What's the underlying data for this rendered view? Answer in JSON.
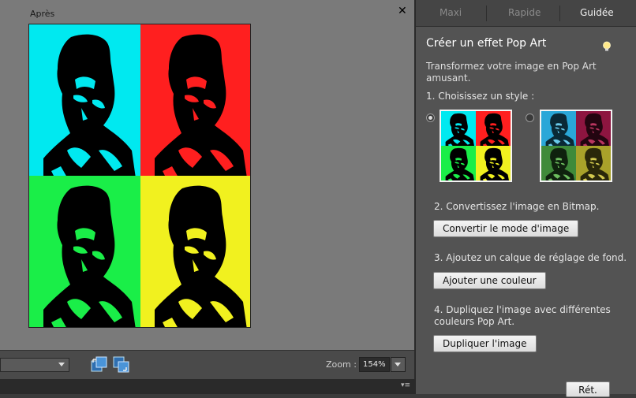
{
  "canvas": {
    "title": "Après",
    "close_symbol": "✕",
    "zoom_label": "Zoom :",
    "zoom_value": "154%"
  },
  "tabs": [
    {
      "label": "Maxi",
      "active": false
    },
    {
      "label": "Rapide",
      "active": false
    },
    {
      "label": "Guidée",
      "active": true
    }
  ],
  "panel": {
    "title": "Créer un effet Pop Art",
    "description": "Transformez votre image en Pop Art amusant.",
    "step1": "1. Choisissez un style :",
    "step2": "2. Convertissez l'image en Bitmap.",
    "step2_button": "Convertir le mode d'image",
    "step3": "3. Ajoutez un calque de réglage de fond.",
    "step3_button": "Ajouter une couleur",
    "step4": "4. Dupliquez l'image avec différentes couleurs Pop Art.",
    "step4_button": "Dupliquer l'image",
    "return_button": "Rét.",
    "style1_selected": true,
    "style2_selected": false
  },
  "colors": {
    "cyan": "#00e9f0",
    "red": "#ff1f1f",
    "green": "#1aee48",
    "yellow": "#f1f11f",
    "panel_bg": "#535353",
    "canvas_bg": "#7a7a7a"
  },
  "icons": {
    "close": "close-icon",
    "bulb": "lightbulb-icon",
    "arrange1": "arrange-windows-icon",
    "arrange2": "float-windows-icon",
    "panel_menu": "panel-menu-icon"
  }
}
